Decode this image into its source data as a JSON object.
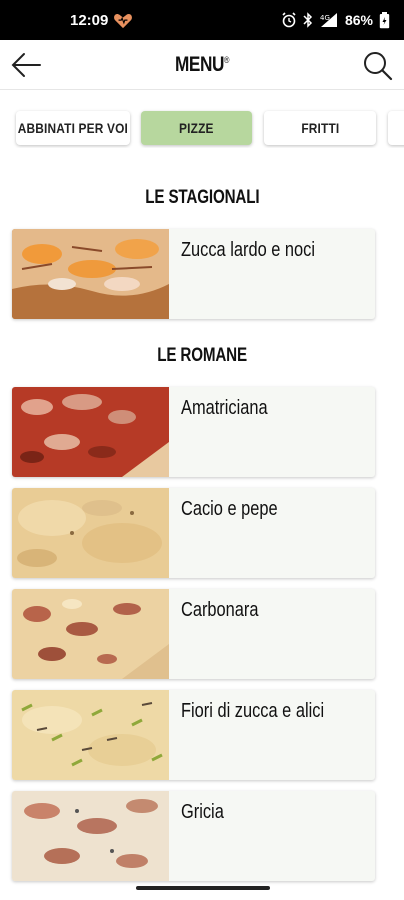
{
  "status_bar": {
    "time": "12:09",
    "battery": "86%"
  },
  "header": {
    "title": "MENU",
    "title_mark": "®"
  },
  "tabs": [
    {
      "label": "ABBINATI PER VOI",
      "active": false
    },
    {
      "label": "PIZZE",
      "active": true
    },
    {
      "label": "FRITTI",
      "active": false
    }
  ],
  "sections": [
    {
      "title": "LE STAGIONALI",
      "items": [
        {
          "name": "Zucca lardo e noci",
          "image": "pumpkin-pizza-photo"
        }
      ]
    },
    {
      "title": "LE ROMANE",
      "items": [
        {
          "name": "Amatriciana",
          "image": "amatriciana-pizza-photo"
        },
        {
          "name": "Cacio e pepe",
          "image": "cacio-pepe-pizza-photo"
        },
        {
          "name": "Carbonara",
          "image": "carbonara-pizza-photo"
        },
        {
          "name": "Fiori di zucca e alici",
          "image": "fiori-zucca-pizza-photo"
        },
        {
          "name": "Gricia",
          "image": "gricia-pizza-photo"
        }
      ]
    }
  ],
  "colors": {
    "active_tab": "#b7d79e",
    "card_bg": "#f6f8f4"
  }
}
